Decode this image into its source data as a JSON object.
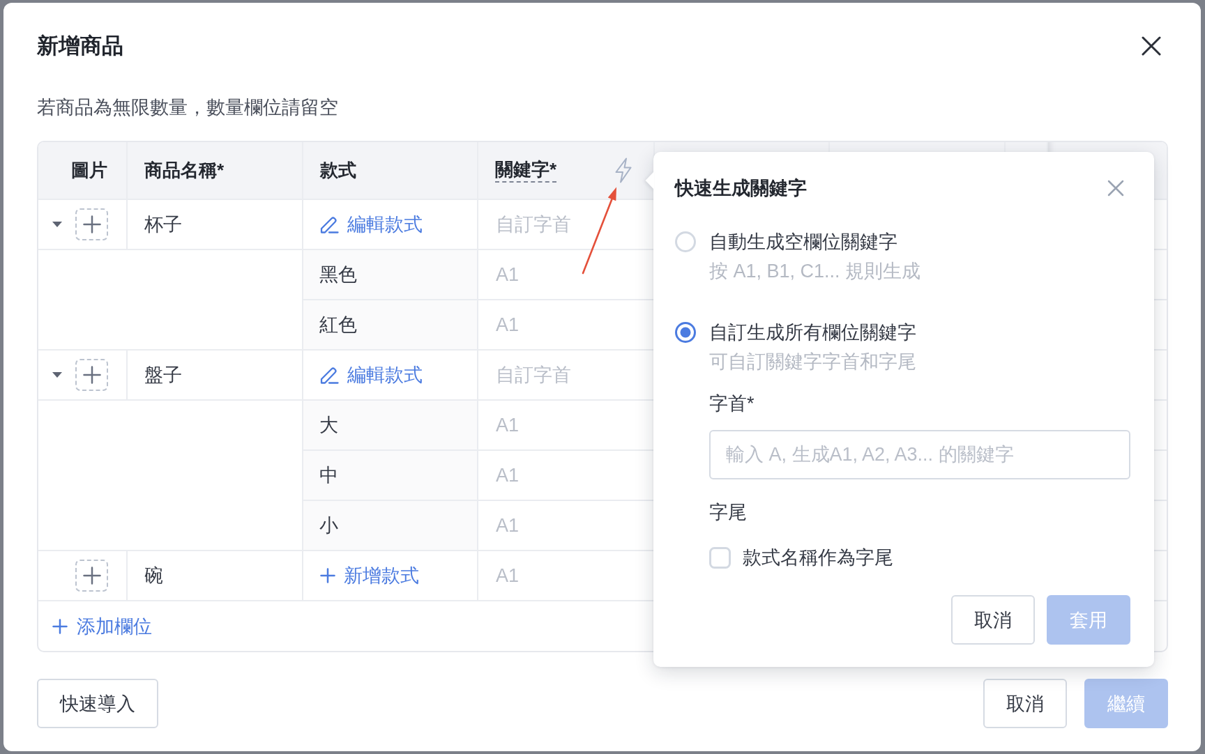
{
  "dialog": {
    "title": "新增商品",
    "hint": "若商品為無限數量，數量欄位請留空"
  },
  "table": {
    "columns": [
      {
        "label": "圖片",
        "kind": "image"
      },
      {
        "label": "商品名稱*",
        "kind": "text"
      },
      {
        "label": "款式",
        "kind": "text"
      },
      {
        "label": "關鍵字*",
        "kind": "generator"
      }
    ],
    "rows": [
      {
        "name": "杯子",
        "expanded": true,
        "style_action": {
          "kind": "edit",
          "label": "編輯款式"
        },
        "keyword": {
          "placeholder": "自訂字首"
        },
        "variants": [
          {
            "name": "黑色",
            "keyword": {
              "placeholder": "A1"
            }
          },
          {
            "name": "紅色",
            "keyword": {
              "placeholder": "A1"
            }
          }
        ]
      },
      {
        "name": "盤子",
        "expanded": true,
        "style_action": {
          "kind": "edit",
          "label": "編輯款式"
        },
        "keyword": {
          "placeholder": "自訂字首"
        },
        "variants": [
          {
            "name": "大",
            "keyword": {
              "placeholder": "A1"
            }
          },
          {
            "name": "中",
            "keyword": {
              "placeholder": "A1"
            }
          },
          {
            "name": "小",
            "keyword": {
              "placeholder": "A1"
            }
          }
        ]
      },
      {
        "name": "碗",
        "style_action": {
          "kind": "add",
          "label": "新增款式"
        },
        "keyword": {
          "placeholder": "A1"
        }
      }
    ],
    "add_field": {
      "label": "添加欄位"
    }
  },
  "popover": {
    "title": "快速生成關鍵字",
    "options": [
      {
        "label": "自動生成空欄位關鍵字",
        "description": "按 A1, B1, C1... 規則生成",
        "selected": false
      },
      {
        "label": "自訂生成所有欄位關鍵字",
        "description": "可自訂關鍵字字首和字尾",
        "selected": true
      }
    ],
    "prefix": {
      "label": "字首*",
      "placeholder": "輸入 A, 生成A1, A2, A3... 的關鍵字"
    },
    "suffix": {
      "label": "字尾",
      "checkbox": {
        "label": "款式名稱作為字尾",
        "checked": false
      }
    },
    "buttons": [
      {
        "label": "取消",
        "kind": "secondary",
        "disabled": false
      },
      {
        "label": "套用",
        "kind": "primary",
        "disabled": true
      }
    ]
  },
  "footer": {
    "left": [
      {
        "label": "快速導入",
        "kind": "secondary",
        "disabled": false
      }
    ],
    "right": [
      {
        "label": "取消",
        "kind": "secondary",
        "disabled": false
      },
      {
        "label": "繼續",
        "kind": "primary",
        "disabled": true
      }
    ]
  }
}
